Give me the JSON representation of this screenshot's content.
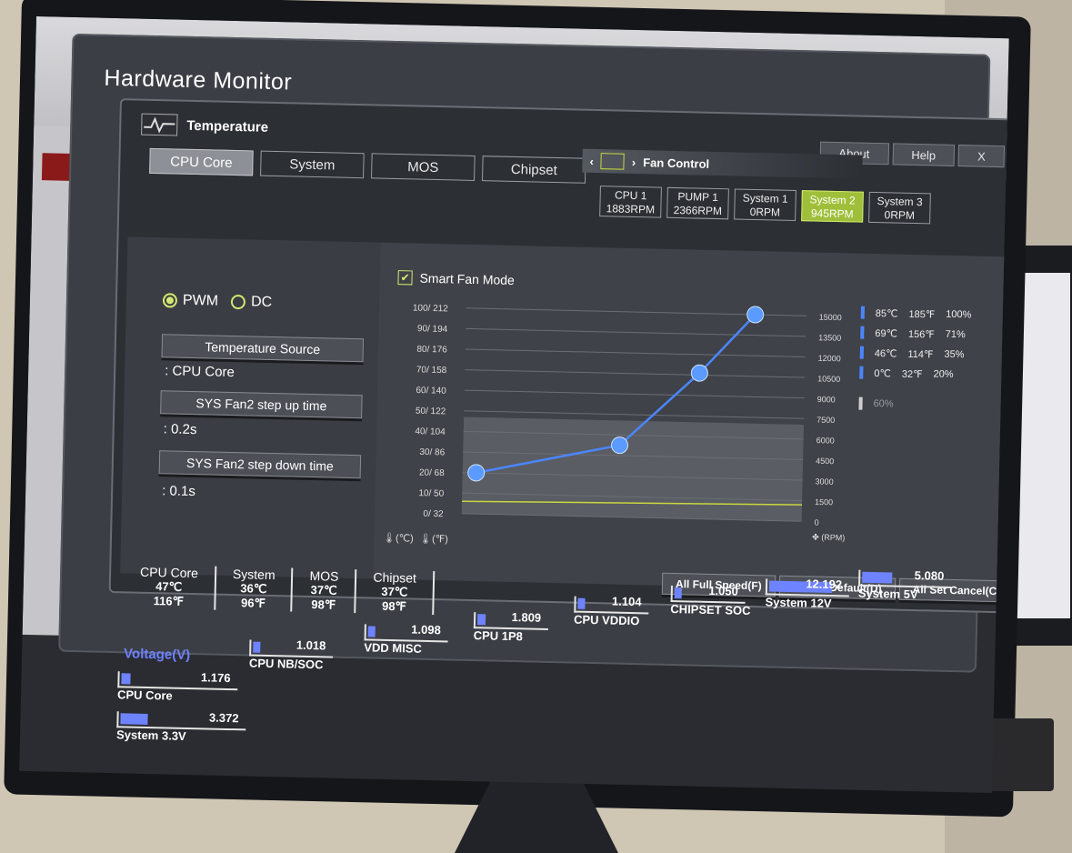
{
  "window": {
    "title": "Hardware Monitor"
  },
  "temperature": {
    "label": "Temperature",
    "tabs": [
      "CPU Core",
      "System",
      "MOS",
      "Chipset"
    ],
    "active_tab": "CPU Core"
  },
  "top_buttons": [
    "About",
    "Help",
    "X"
  ],
  "fan_control": {
    "label": "Fan Control",
    "fans": [
      {
        "name": "CPU 1",
        "rpm": "1883RPM",
        "active": false
      },
      {
        "name": "PUMP 1",
        "rpm": "2366RPM",
        "active": false
      },
      {
        "name": "System 1",
        "rpm": "0RPM",
        "active": false
      },
      {
        "name": "System 2",
        "rpm": "945RPM",
        "active": true
      },
      {
        "name": "System 3",
        "rpm": "0RPM",
        "active": false
      }
    ]
  },
  "left_panel": {
    "pwm_label": "PWM",
    "dc_label": "DC",
    "temp_source_button": "Temperature Source",
    "temp_source_value": ": CPU Core",
    "step_up_button": "SYS Fan2 step up time",
    "step_up_value": ": 0.2s",
    "step_down_button": "SYS Fan2 step down time",
    "step_down_value": ": 0.1s"
  },
  "chart": {
    "smart_fan_label": "Smart Fan Mode",
    "unit_c": "(℃)",
    "unit_f": "(℉)",
    "rpm_unit": "(RPM)"
  },
  "chart_data": {
    "type": "line",
    "left_ticks": [
      "100/ 212",
      "90/ 194",
      "80/ 176",
      "70/ 158",
      "60/ 140",
      "50/ 122",
      "40/ 104",
      "30/ 86",
      "20/ 68",
      "10/ 50",
      "0/ 32"
    ],
    "right_ticks": [
      "15000",
      "13500",
      "12000",
      "10500",
      "9000",
      "7500",
      "6000",
      "4500",
      "3000",
      "1500",
      "0"
    ],
    "ylim": [
      0,
      100
    ],
    "xlim": [
      0,
      100
    ],
    "points": [
      {
        "temp_c": 0,
        "fan_pct": 20
      },
      {
        "temp_c": 46,
        "fan_pct": 35
      },
      {
        "temp_c": 69,
        "fan_pct": 71
      },
      {
        "temp_c": 85,
        "fan_pct": 100
      }
    ],
    "legend": [
      {
        "c": "85℃",
        "f": "185℉",
        "pct": "100%"
      },
      {
        "c": "69℃",
        "f": "156℉",
        "pct": "71%"
      },
      {
        "c": "46℃",
        "f": "114℉",
        "pct": "35%"
      },
      {
        "c": "0℃",
        "f": "32℉",
        "pct": "20%"
      }
    ],
    "extra_legend": "60%"
  },
  "bottom_buttons": [
    "All Full Speed(F)",
    "All Set Default(D)",
    "All Set Cancel(C)"
  ],
  "temp_readouts": [
    {
      "name": "CPU Core",
      "c": "47℃",
      "f": "116℉"
    },
    {
      "name": "System",
      "c": "36℃",
      "f": "96℉"
    },
    {
      "name": "MOS",
      "c": "37℃",
      "f": "98℉"
    },
    {
      "name": "Chipset",
      "c": "37℃",
      "f": "98℉"
    }
  ],
  "voltage": {
    "title": "Voltage(V)",
    "items": [
      {
        "name": "CPU Core",
        "value": "1.176",
        "fill": 0.08
      },
      {
        "name": "CPU NB/SOC",
        "value": "1.018",
        "fill": 0.07
      },
      {
        "name": "VDD MISC",
        "value": "1.098",
        "fill": 0.07
      },
      {
        "name": "CPU 1P8",
        "value": "1.809",
        "fill": 0.12
      },
      {
        "name": "CPU VDDIO",
        "value": "1.104",
        "fill": 0.07
      },
      {
        "name": "CHIPSET SOC",
        "value": "1.050",
        "fill": 0.07
      },
      {
        "name": "System 12V",
        "value": "12.192",
        "fill": 0.8
      },
      {
        "name": "System 5V",
        "value": "5.080",
        "fill": 0.34
      },
      {
        "name": "System 3.3V",
        "value": "3.372",
        "fill": 0.22
      }
    ]
  },
  "colors": {
    "accent": "#d3e870",
    "chart_blue": "#4b86ff",
    "voltage_blue": "#6e83ff"
  }
}
